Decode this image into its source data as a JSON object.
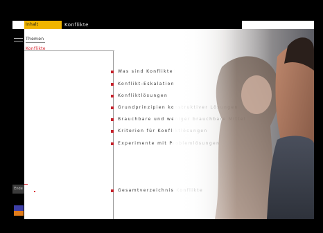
{
  "header": {
    "active_tab_label": "Inhalt",
    "section_title": "Konflikte"
  },
  "left_nav": {
    "item_1": "Themen",
    "item_2": "Konflikte"
  },
  "menu": {
    "items": [
      "Was sind Konflikte?",
      "Konflikt-Eskalation",
      "Konfliktlösungen",
      "Grundprinzipien konstruktiver Lösungen",
      "Brauchbare und weniger brauchbare Mittel",
      "Kriterien für Konfliktlösungen",
      "Experimente mit Problemlösungen"
    ],
    "footer_item": "Gesamtverzeichnis Konflikte"
  },
  "rail": {
    "button_label": "Ende"
  },
  "colors": {
    "accent_yellow": "#f0b400",
    "bullet_red": "#c3202a",
    "frame_black": "#000000"
  }
}
